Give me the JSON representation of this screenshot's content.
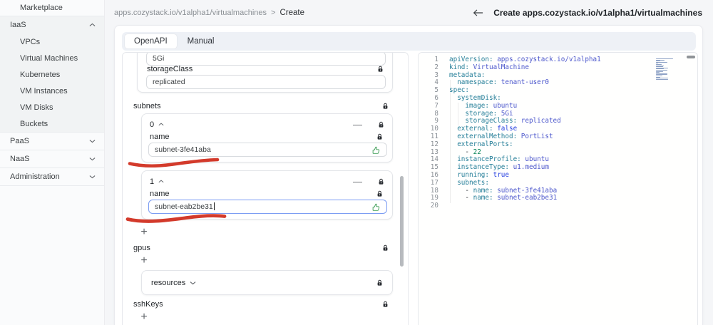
{
  "sidebar": {
    "items": [
      {
        "label": "Marketplace",
        "type": "sub",
        "first": true,
        "divider_after": true
      },
      {
        "label": "IaaS",
        "type": "top",
        "chevron": "up",
        "gray": true
      },
      {
        "label": "VPCs",
        "type": "sub",
        "gray": true
      },
      {
        "label": "Virtual Machines",
        "type": "sub",
        "gray": true
      },
      {
        "label": "Kubernetes",
        "type": "sub",
        "gray": true
      },
      {
        "label": "VM Instances",
        "type": "sub",
        "gray": true
      },
      {
        "label": "VM Disks",
        "type": "sub",
        "gray": true
      },
      {
        "label": "Buckets",
        "type": "sub",
        "gray": true,
        "divider_after": true
      },
      {
        "label": "PaaS",
        "type": "top",
        "chevron": "down",
        "divider_after": true
      },
      {
        "label": "NaaS",
        "type": "top",
        "chevron": "down",
        "divider_after": true
      },
      {
        "label": "Administration",
        "type": "top",
        "chevron": "down",
        "divider_after": true
      }
    ]
  },
  "header": {
    "breadcrumb_path": "apps.cozystack.io/v1alpha1/virtualmachines",
    "breadcrumb_sep": ">",
    "breadcrumb_current": "Create",
    "title": "Create apps.cozystack.io/v1alpha1/virtualmachines"
  },
  "tabs": {
    "openapi": "OpenAPI",
    "manual": "Manual"
  },
  "form": {
    "storage_value": "5Gi",
    "storageclass_label": "storageClass",
    "storageclass_value": "replicated",
    "subnets_label": "subnets",
    "subnet_items": [
      {
        "index": "0",
        "name_label": "name",
        "value": "subnet-3fe41aba"
      },
      {
        "index": "1",
        "name_label": "name",
        "value": "subnet-eab2be31"
      }
    ],
    "remove_label": "—",
    "add_label": "+",
    "gpus_label": "gpus",
    "resources_label": "resources",
    "sshkeys_label": "sshKeys"
  },
  "colors": {
    "annotation_red": "#d33a2b",
    "thumb_green": "#3f9e57",
    "key": "#267f99",
    "value": "#4c57cc",
    "boolean": "#2741e0",
    "number": "#098658"
  },
  "editor": {
    "lines": [
      {
        "n": 1,
        "s": [
          [
            "k",
            "apiVersion:"
          ],
          [
            "d",
            " "
          ],
          [
            "v",
            "apps.cozystack.io/v1alpha1"
          ]
        ]
      },
      {
        "n": 2,
        "s": [
          [
            "k",
            "kind:"
          ],
          [
            "d",
            " "
          ],
          [
            "v",
            "VirtualMachine"
          ]
        ]
      },
      {
        "n": 3,
        "s": [
          [
            "k",
            "metadata:"
          ]
        ]
      },
      {
        "n": 4,
        "s": [
          [
            "d",
            "  "
          ],
          [
            "k",
            "namespace:"
          ],
          [
            "d",
            " "
          ],
          [
            "v",
            "tenant-user0"
          ]
        ]
      },
      {
        "n": 5,
        "s": [
          [
            "k",
            "spec:"
          ]
        ]
      },
      {
        "n": 6,
        "s": [
          [
            "d",
            "  "
          ],
          [
            "k",
            "systemDisk:"
          ]
        ]
      },
      {
        "n": 7,
        "s": [
          [
            "d",
            "    "
          ],
          [
            "k",
            "image:"
          ],
          [
            "d",
            " "
          ],
          [
            "v",
            "ubuntu"
          ]
        ]
      },
      {
        "n": 8,
        "s": [
          [
            "d",
            "    "
          ],
          [
            "k",
            "storage:"
          ],
          [
            "d",
            " "
          ],
          [
            "v",
            "5Gi"
          ]
        ]
      },
      {
        "n": 9,
        "s": [
          [
            "d",
            "    "
          ],
          [
            "k",
            "storageClass:"
          ],
          [
            "d",
            " "
          ],
          [
            "v",
            "replicated"
          ]
        ]
      },
      {
        "n": 10,
        "s": [
          [
            "d",
            "  "
          ],
          [
            "k",
            "external:"
          ],
          [
            "d",
            " "
          ],
          [
            "b",
            "false"
          ]
        ]
      },
      {
        "n": 11,
        "s": [
          [
            "d",
            "  "
          ],
          [
            "k",
            "externalMethod:"
          ],
          [
            "d",
            " "
          ],
          [
            "v",
            "PortList"
          ]
        ]
      },
      {
        "n": 12,
        "s": [
          [
            "d",
            "  "
          ],
          [
            "k",
            "externalPorts:"
          ]
        ]
      },
      {
        "n": 13,
        "s": [
          [
            "d",
            "    - "
          ],
          [
            "n",
            "22"
          ]
        ]
      },
      {
        "n": 14,
        "s": [
          [
            "d",
            "  "
          ],
          [
            "k",
            "instanceProfile:"
          ],
          [
            "d",
            " "
          ],
          [
            "v",
            "ubuntu"
          ]
        ]
      },
      {
        "n": 15,
        "s": [
          [
            "d",
            "  "
          ],
          [
            "k",
            "instanceType:"
          ],
          [
            "d",
            " "
          ],
          [
            "v",
            "u1.medium"
          ]
        ]
      },
      {
        "n": 16,
        "s": [
          [
            "d",
            "  "
          ],
          [
            "k",
            "running:"
          ],
          [
            "d",
            " "
          ],
          [
            "b",
            "true"
          ]
        ]
      },
      {
        "n": 17,
        "s": [
          [
            "d",
            "  "
          ],
          [
            "k",
            "subnets:"
          ]
        ]
      },
      {
        "n": 18,
        "s": [
          [
            "d",
            "    - "
          ],
          [
            "k",
            "name:"
          ],
          [
            "d",
            " "
          ],
          [
            "v",
            "subnet-3fe41aba"
          ]
        ]
      },
      {
        "n": 19,
        "s": [
          [
            "d",
            "    - "
          ],
          [
            "k",
            "name:"
          ],
          [
            "d",
            " "
          ],
          [
            "v",
            "subnet-eab2be31"
          ]
        ]
      },
      {
        "n": 20,
        "s": []
      }
    ]
  }
}
